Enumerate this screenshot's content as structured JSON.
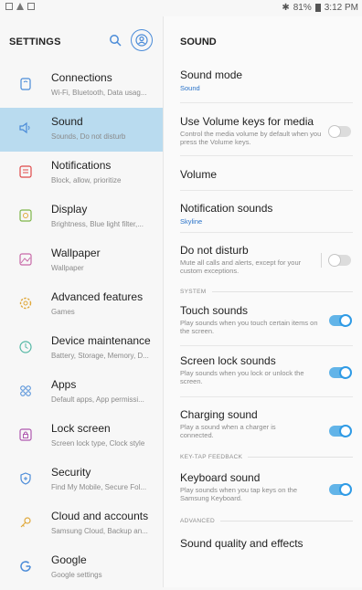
{
  "status_bar": {
    "battery_percent": "81%",
    "time": "3:12 PM",
    "icons": [
      "gallery-icon",
      "warning-icon",
      "screenshot-icon",
      "bluetooth-icon",
      "battery-icon"
    ]
  },
  "left_pane": {
    "title": "SETTINGS",
    "items": [
      {
        "title": "Connections",
        "subtitle": "Wi-Fi, Bluetooth, Data usag...",
        "icon": "connections-icon"
      },
      {
        "title": "Sound",
        "subtitle": "Sounds, Do not disturb",
        "icon": "sound-icon",
        "selected": true
      },
      {
        "title": "Notifications",
        "subtitle": "Block, allow, prioritize",
        "icon": "notifications-icon"
      },
      {
        "title": "Display",
        "subtitle": "Brightness, Blue light filter,...",
        "icon": "display-icon"
      },
      {
        "title": "Wallpaper",
        "subtitle": "Wallpaper",
        "icon": "wallpaper-icon"
      },
      {
        "title": "Advanced features",
        "subtitle": "Games",
        "icon": "advanced-features-icon"
      },
      {
        "title": "Device maintenance",
        "subtitle": "Battery, Storage, Memory, D...",
        "icon": "device-maintenance-icon"
      },
      {
        "title": "Apps",
        "subtitle": "Default apps, App permissi...",
        "icon": "apps-icon"
      },
      {
        "title": "Lock screen",
        "subtitle": "Screen lock type, Clock style",
        "icon": "lock-screen-icon"
      },
      {
        "title": "Security",
        "subtitle": "Find My Mobile, Secure Fol...",
        "icon": "security-icon"
      },
      {
        "title": "Cloud and accounts",
        "subtitle": "Samsung Cloud, Backup an...",
        "icon": "cloud-accounts-icon"
      },
      {
        "title": "Google",
        "subtitle": "Google settings",
        "icon": "google-icon"
      }
    ]
  },
  "right_pane": {
    "title": "SOUND",
    "sound_mode": {
      "title": "Sound mode",
      "value": "Sound"
    },
    "volume_keys": {
      "title": "Use Volume keys for media",
      "subtitle": "Control the media volume by default when you press the Volume keys.",
      "enabled": false
    },
    "volume": {
      "title": "Volume"
    },
    "notification_sounds": {
      "title": "Notification sounds",
      "value": "Skyline"
    },
    "do_not_disturb": {
      "title": "Do not disturb",
      "subtitle": "Mute all calls and alerts, except for your custom exceptions.",
      "enabled": false
    },
    "section_system": "SYSTEM",
    "touch_sounds": {
      "title": "Touch sounds",
      "subtitle": "Play sounds when you touch certain items on the screen.",
      "enabled": true
    },
    "screen_lock_sounds": {
      "title": "Screen lock sounds",
      "subtitle": "Play sounds when you lock or unlock the screen.",
      "enabled": true
    },
    "charging_sound": {
      "title": "Charging sound",
      "subtitle": "Play a sound when a charger is connected.",
      "enabled": true
    },
    "section_keytap": "KEY-TAP FEEDBACK",
    "keyboard_sound": {
      "title": "Keyboard sound",
      "subtitle": "Play sounds when you tap keys on the Samsung Keyboard.",
      "enabled": true
    },
    "section_advanced": "ADVANCED",
    "sound_quality": {
      "title": "Sound quality and effects"
    }
  },
  "colors": {
    "accent": "#2e9ae5",
    "selected_bg": "#b9dbef",
    "value_text": "#2a73c9"
  }
}
